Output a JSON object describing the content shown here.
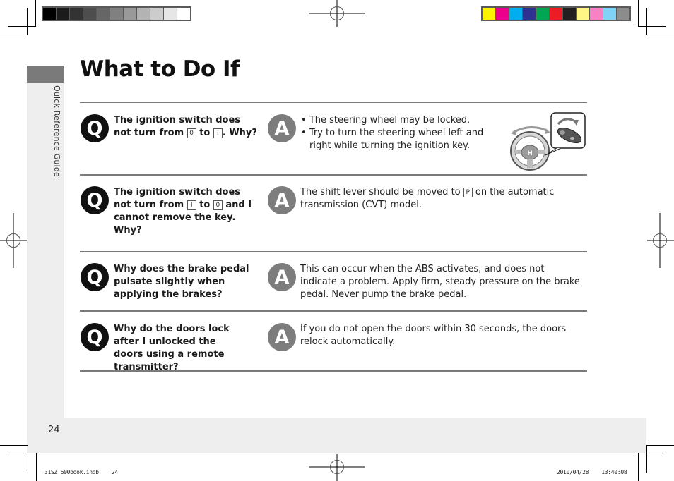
{
  "colors": {
    "gray_swatches": [
      "#000000",
      "#1b1b1b",
      "#333333",
      "#4d4d4d",
      "#666666",
      "#808080",
      "#999999",
      "#b3b3b3",
      "#cccccc",
      "#e6e6e6",
      "#ffffff"
    ],
    "color_swatches": [
      "#fff200",
      "#ec008c",
      "#00aeef",
      "#2e3192",
      "#00a651",
      "#ed1c24",
      "#231f20",
      "#fff685",
      "#f681c5",
      "#7fd3f7",
      "#8c8c8c"
    ],
    "q_icon": "#111111",
    "a_icon": "#7d7d7d",
    "section_tab": "#7a7a7a"
  },
  "sidebar": {
    "label": "Quick Reference Guide"
  },
  "page": {
    "title": "What to Do If",
    "number": "24"
  },
  "qa": [
    {
      "q_icon": "Q",
      "a_icon": "A",
      "question": {
        "parts": [
          "The ignition switch does not turn from ",
          "0",
          " to ",
          "I",
          ". Why?"
        ]
      },
      "answer": {
        "bullets": [
          "The steering wheel may be locked.",
          "Try to turn the steering wheel left and right while turning the ignition key."
        ]
      },
      "illustration": "steering-wheel-and-ignition-key"
    },
    {
      "q_icon": "Q",
      "a_icon": "A",
      "question": {
        "parts": [
          "The ignition switch does not turn from ",
          "I",
          " to ",
          "0",
          " and I cannot remove the key. Why?"
        ]
      },
      "answer": {
        "parts": [
          "The shift lever should be moved to ",
          "P",
          " on the automatic transmission (CVT) model."
        ]
      }
    },
    {
      "q_icon": "Q",
      "a_icon": "A",
      "question": {
        "text": "Why does the brake pedal pulsate slightly when applying the brakes?"
      },
      "answer": {
        "text": "This can occur when the ABS activates, and does not indicate a problem. Apply firm, steady pressure on the brake pedal. Never pump the brake pedal."
      }
    },
    {
      "q_icon": "Q",
      "a_icon": "A",
      "question": {
        "text": "Why do the doors lock after I unlocked the doors using a remote transmitter?"
      },
      "answer": {
        "text": "If you do not open the doors within 30 seconds, the doors relock automatically."
      }
    }
  ],
  "slug": {
    "file": "31SZT600book.indb    24",
    "timestamp": "2010/04/28    13:40:08"
  }
}
